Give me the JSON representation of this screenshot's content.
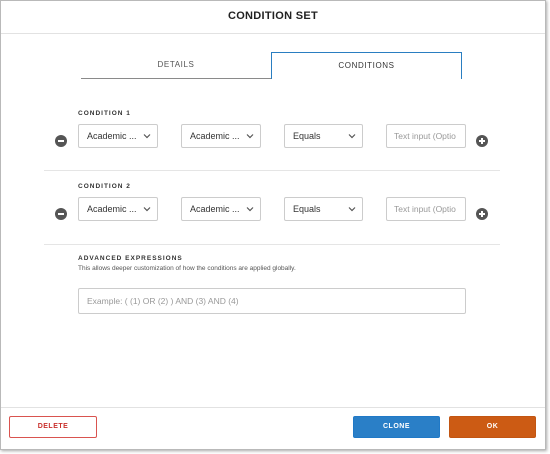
{
  "dialog": {
    "title": "CONDITION SET"
  },
  "tabs": [
    {
      "label": "DETAILS",
      "active": false
    },
    {
      "label": "CONDITIONS",
      "active": true
    }
  ],
  "conditions": [
    {
      "label": "CONDITION 1",
      "field1": "Academic ...",
      "field2": "Academic ...",
      "operator": "Equals",
      "value_placeholder": "Text input (Optio"
    },
    {
      "label": "CONDITION 2",
      "field1": "Academic ...",
      "field2": "Academic ...",
      "operator": "Equals",
      "value_placeholder": "Text input (Optio"
    }
  ],
  "advanced": {
    "title": "ADVANCED EXPRESSIONS",
    "description": "This allows deeper customization of how the conditions are applied globally.",
    "placeholder": "Example: ( (1) OR (2) ) AND (3) AND (4)"
  },
  "footer": {
    "delete_label": "DELETE",
    "clone_label": "CLONE",
    "ok_label": "OK"
  },
  "colors": {
    "accent_blue": "#2a7fc7",
    "ok_orange": "#cc5b14",
    "delete_red": "#d9534f"
  },
  "icons": {
    "remove": "minus-circle-icon",
    "add": "plus-circle-icon",
    "dropdown": "chevron-down-icon"
  }
}
